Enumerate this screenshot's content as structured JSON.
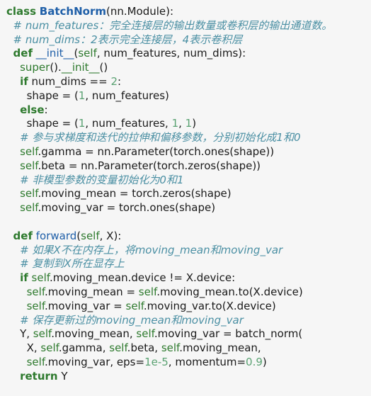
{
  "code": {
    "lines": [
      {
        "indent": 0,
        "tokens": [
          {
            "t": "kw",
            "s": "class"
          },
          {
            "t": "txt",
            "s": " "
          },
          {
            "t": "cls",
            "s": "BatchNorm"
          },
          {
            "t": "txt",
            "s": "(nn.Module):"
          }
        ]
      },
      {
        "indent": 1,
        "tokens": [
          {
            "t": "com",
            "s": "# num_features：完全连接层的输出数量或卷积层的输出通道数。"
          }
        ]
      },
      {
        "indent": 1,
        "tokens": [
          {
            "t": "com",
            "s": "# num_dims：2表示完全连接层，4表示卷积层"
          }
        ]
      },
      {
        "indent": 1,
        "tokens": [
          {
            "t": "kw",
            "s": "def"
          },
          {
            "t": "txt",
            "s": " "
          },
          {
            "t": "fn",
            "s": "__init__"
          },
          {
            "t": "txt",
            "s": "("
          },
          {
            "t": "self",
            "s": "self"
          },
          {
            "t": "txt",
            "s": ", num_features, num_dims):"
          }
        ]
      },
      {
        "indent": 2,
        "tokens": [
          {
            "t": "self",
            "s": "super"
          },
          {
            "t": "txt",
            "s": "()."
          },
          {
            "t": "self",
            "s": "__init__"
          },
          {
            "t": "txt",
            "s": "()"
          }
        ]
      },
      {
        "indent": 2,
        "tokens": [
          {
            "t": "kw",
            "s": "if"
          },
          {
            "t": "txt",
            "s": " num_dims == "
          },
          {
            "t": "num",
            "s": "2"
          },
          {
            "t": "txt",
            "s": ":"
          }
        ]
      },
      {
        "indent": 3,
        "tokens": [
          {
            "t": "txt",
            "s": "shape = ("
          },
          {
            "t": "num",
            "s": "1"
          },
          {
            "t": "txt",
            "s": ", num_features)"
          }
        ]
      },
      {
        "indent": 2,
        "tokens": [
          {
            "t": "kw",
            "s": "else"
          },
          {
            "t": "txt",
            "s": ":"
          }
        ]
      },
      {
        "indent": 3,
        "tokens": [
          {
            "t": "txt",
            "s": "shape = ("
          },
          {
            "t": "num",
            "s": "1"
          },
          {
            "t": "txt",
            "s": ", num_features, "
          },
          {
            "t": "num",
            "s": "1"
          },
          {
            "t": "txt",
            "s": ", "
          },
          {
            "t": "num",
            "s": "1"
          },
          {
            "t": "txt",
            "s": ")"
          }
        ]
      },
      {
        "indent": 2,
        "tokens": [
          {
            "t": "com",
            "s": "# 参与求梯度和迭代的拉伸和偏移参数，分别初始化成1和0"
          }
        ]
      },
      {
        "indent": 2,
        "tokens": [
          {
            "t": "self",
            "s": "self"
          },
          {
            "t": "txt",
            "s": ".gamma = nn.Parameter(torch.ones(shape))"
          }
        ]
      },
      {
        "indent": 2,
        "tokens": [
          {
            "t": "self",
            "s": "self"
          },
          {
            "t": "txt",
            "s": ".beta = nn.Parameter(torch.zeros(shape))"
          }
        ]
      },
      {
        "indent": 2,
        "tokens": [
          {
            "t": "com",
            "s": "# 非模型参数的变量初始化为0和1"
          }
        ]
      },
      {
        "indent": 2,
        "tokens": [
          {
            "t": "self",
            "s": "self"
          },
          {
            "t": "txt",
            "s": ".moving_mean = torch.zeros(shape)"
          }
        ]
      },
      {
        "indent": 2,
        "tokens": [
          {
            "t": "self",
            "s": "self"
          },
          {
            "t": "txt",
            "s": ".moving_var = torch.ones(shape)"
          }
        ]
      },
      {
        "indent": 0,
        "tokens": []
      },
      {
        "indent": 1,
        "tokens": [
          {
            "t": "kw",
            "s": "def"
          },
          {
            "t": "txt",
            "s": " "
          },
          {
            "t": "fn",
            "s": "forward"
          },
          {
            "t": "txt",
            "s": "("
          },
          {
            "t": "self",
            "s": "self"
          },
          {
            "t": "txt",
            "s": ", X):"
          }
        ]
      },
      {
        "indent": 2,
        "tokens": [
          {
            "t": "com",
            "s": "# 如果X不在内存上，将moving_mean和moving_var"
          }
        ]
      },
      {
        "indent": 2,
        "tokens": [
          {
            "t": "com",
            "s": "# 复制到X所在显存上"
          }
        ]
      },
      {
        "indent": 2,
        "tokens": [
          {
            "t": "kw",
            "s": "if"
          },
          {
            "t": "txt",
            "s": " "
          },
          {
            "t": "self",
            "s": "self"
          },
          {
            "t": "txt",
            "s": ".moving_mean.device != X.device:"
          }
        ]
      },
      {
        "indent": 3,
        "tokens": [
          {
            "t": "self",
            "s": "self"
          },
          {
            "t": "txt",
            "s": ".moving_mean = "
          },
          {
            "t": "self",
            "s": "self"
          },
          {
            "t": "txt",
            "s": ".moving_mean.to(X.device)"
          }
        ]
      },
      {
        "indent": 3,
        "tokens": [
          {
            "t": "self",
            "s": "self"
          },
          {
            "t": "txt",
            "s": ".moving_var = "
          },
          {
            "t": "self",
            "s": "self"
          },
          {
            "t": "txt",
            "s": ".moving_var.to(X.device)"
          }
        ]
      },
      {
        "indent": 2,
        "tokens": [
          {
            "t": "com",
            "s": "# 保存更新过的moving_mean和moving_var"
          }
        ]
      },
      {
        "indent": 2,
        "tokens": [
          {
            "t": "txt",
            "s": "Y, "
          },
          {
            "t": "self",
            "s": "self"
          },
          {
            "t": "txt",
            "s": ".moving_mean, "
          },
          {
            "t": "self",
            "s": "self"
          },
          {
            "t": "txt",
            "s": ".moving_var = batch_norm("
          }
        ]
      },
      {
        "indent": 3,
        "tokens": [
          {
            "t": "txt",
            "s": "X, "
          },
          {
            "t": "self",
            "s": "self"
          },
          {
            "t": "txt",
            "s": ".gamma, "
          },
          {
            "t": "self",
            "s": "self"
          },
          {
            "t": "txt",
            "s": ".beta, "
          },
          {
            "t": "self",
            "s": "self"
          },
          {
            "t": "txt",
            "s": ".moving_mean,"
          }
        ]
      },
      {
        "indent": 3,
        "tokens": [
          {
            "t": "self",
            "s": "self"
          },
          {
            "t": "txt",
            "s": ".moving_var, eps="
          },
          {
            "t": "num",
            "s": "1e-5"
          },
          {
            "t": "txt",
            "s": ", momentum="
          },
          {
            "t": "num",
            "s": "0.9"
          },
          {
            "t": "txt",
            "s": ")"
          }
        ]
      },
      {
        "indent": 2,
        "tokens": [
          {
            "t": "kw",
            "s": "return"
          },
          {
            "t": "txt",
            "s": " Y"
          }
        ]
      }
    ]
  },
  "colors": {
    "background": "#f6f6f6",
    "keyword": "#2e7a2e",
    "class_name": "#1f5fa8",
    "function_name": "#1f5fa8",
    "self_builtin": "#2e7a2e",
    "number": "#5aa272",
    "comment": "#4a8fa3",
    "text": "#1a1a1a"
  }
}
